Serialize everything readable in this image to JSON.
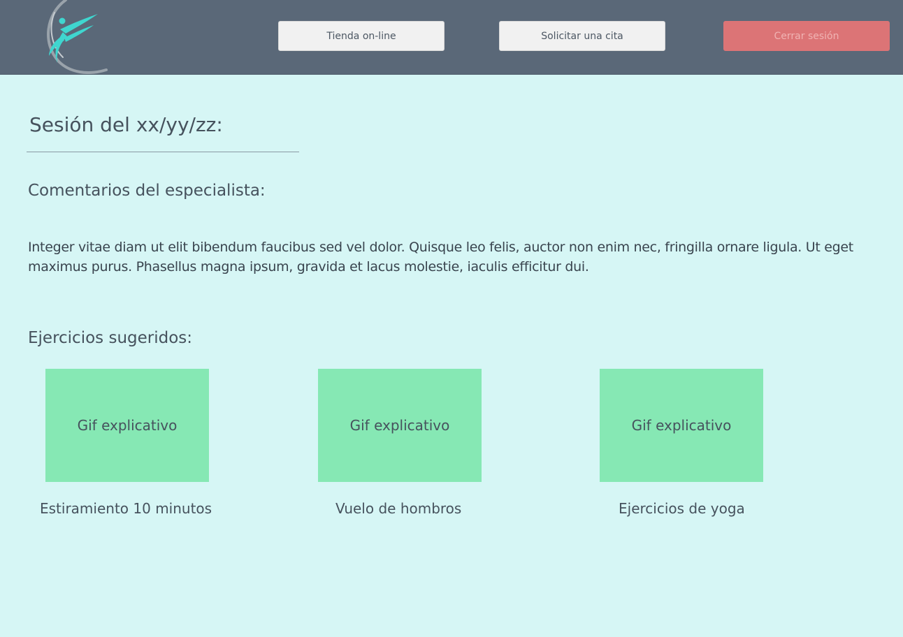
{
  "header": {
    "logo_icon": "dancer-logo-icon",
    "nav": {
      "shop_label": "Tienda on-line",
      "appointment_label": "Solicitar una cita",
      "logout_label": "Cerrar sesión"
    },
    "colors": {
      "header_bg": "#5a6878",
      "logout_bg": "#dc7476",
      "logo_accent": "#3fd6cf"
    }
  },
  "main": {
    "session_title": "Sesión del xx/yy/zz:",
    "comments_heading": "Comentarios del especialista:",
    "comments_text": "Integer vitae diam ut elit bibendum faucibus sed vel dolor. Quisque leo felis, auctor non enim nec, fringilla ornare ligula. Ut eget maximus purus. Phasellus magna ipsum, gravida et lacus molestie, iaculis efficitur dui.",
    "exercises_heading": "Ejercicios sugeridos:",
    "exercises": [
      {
        "gif_label": "Gif explicativo",
        "name": "Estiramiento 10 minutos"
      },
      {
        "gif_label": "Gif explicativo",
        "name": "Vuelo de hombros"
      },
      {
        "gif_label": "Gif explicativo",
        "name": "Ejercicios de yoga"
      }
    ],
    "colors": {
      "page_bg": "#d6f6f5",
      "gif_bg": "#86e8b4"
    }
  }
}
